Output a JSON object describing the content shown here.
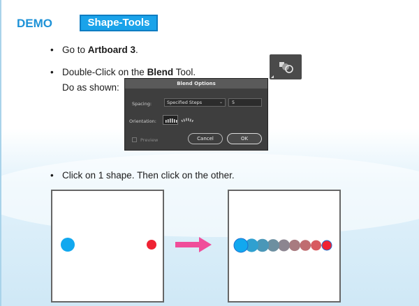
{
  "header": {
    "demo_label": "DEMO",
    "tag_label": "Shape-Tools"
  },
  "bullets": [
    {
      "pre": "Go to ",
      "bold": "Artboard 3",
      "post": "."
    },
    {
      "pre": "Double-Click on the ",
      "bold": "Blend",
      "post": " Tool."
    },
    {
      "text": "Click on 1 shape. Then click on the other."
    }
  ],
  "instruction": "Do as shown:",
  "dialog": {
    "title": "Blend Options",
    "spacing_label": "Spacing:",
    "spacing_value": "Specified Steps",
    "steps_value": "5",
    "orientation_label": "Orientation:",
    "preview_label": "Preview",
    "cancel_label": "Cancel",
    "ok_label": "OK"
  },
  "colors": {
    "accent": "#1aa3ea",
    "start_shape": "#11a8ef",
    "end_shape": "#ef2233",
    "arrow": "#f04d9a",
    "blend_steps": [
      "#11a8ef",
      "#2fa0d0",
      "#4a97b8",
      "#6d8fa0",
      "#8c8590",
      "#a87b80",
      "#c06d70",
      "#d85a60",
      "#ef2233"
    ]
  },
  "icons": {
    "blend_tool": "blend-tool-icon",
    "arrow": "arrow-right-icon"
  }
}
